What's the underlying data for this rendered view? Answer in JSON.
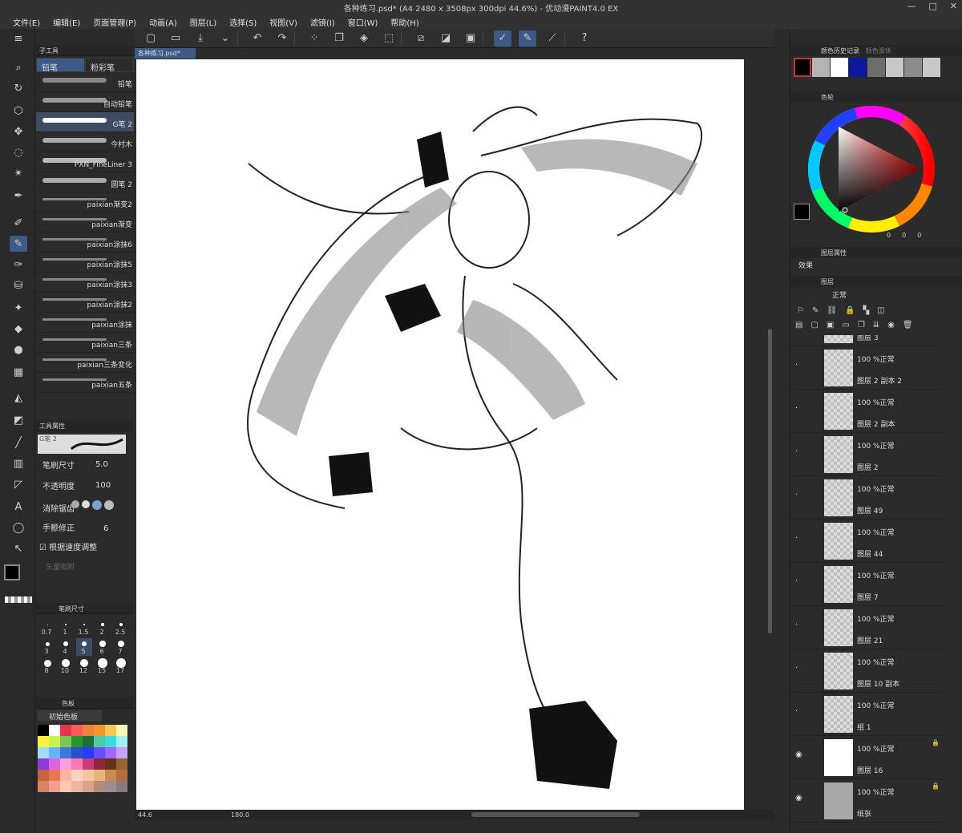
{
  "window": {
    "title": "各种练习.psd* (A4 2480 x 3508px 300dpi 44.6%) - 优动漫PAINT4.0 EX",
    "buttons": [
      "—",
      "□",
      "✕"
    ]
  },
  "menu": [
    "文件(E)",
    "编辑(E)",
    "页面管理(P)",
    "动画(A)",
    "图层(L)",
    "选择(S)",
    "视图(V)",
    "滤镜(I)",
    "窗口(W)",
    "帮助(H)"
  ],
  "subtool": {
    "header": "子工具",
    "tabs": [
      "铅笔",
      "粉彩笔"
    ],
    "brushes": [
      {
        "label": "铅笔",
        "color": "#888"
      },
      {
        "label": "自动铅笔",
        "color": "#9a9a9a"
      },
      {
        "label": "G笔 2",
        "color": "#ffffff"
      },
      {
        "label": "今村木",
        "color": "#aaaaaa"
      },
      {
        "label": "PXN_FineLiner 3",
        "color": "#bbbbbb"
      },
      {
        "label": "圆笔 2",
        "color": "#aaaaaa"
      },
      {
        "label": "paixian渐变2",
        "color": "#888"
      },
      {
        "label": "paixian渐变",
        "color": "#888"
      },
      {
        "label": "paixian涂抹6",
        "color": "#888"
      },
      {
        "label": "paixian涂抹5",
        "color": "#888"
      },
      {
        "label": "paixian涂抹3",
        "color": "#888"
      },
      {
        "label": "paixian涂抹2",
        "color": "#888"
      },
      {
        "label": "paixian涂抹",
        "color": "#888"
      },
      {
        "label": "paixian三条",
        "color": "#888"
      },
      {
        "label": "paixian三条变化",
        "color": "#888"
      },
      {
        "label": "paixian五条",
        "color": "#888"
      }
    ]
  },
  "toolprops": {
    "header": "工具属性",
    "brush_name": "G笔 2",
    "size_label": "笔刷尺寸",
    "size_value": "5.0",
    "opacity_label": "不透明度",
    "opacity_value": "100",
    "antialias_label": "消除锯齿",
    "stabilize_label": "手颤修正",
    "stabilize_value": "6",
    "speed_label": "根据速度调整",
    "vector_label": "矢量吸附"
  },
  "brushsize": {
    "header": "笔刷尺寸",
    "sizes": [
      "0.7",
      "1",
      "1.5",
      "2",
      "2.5",
      "3",
      "4",
      "5",
      "6",
      "7",
      "8",
      "10",
      "12",
      "15",
      "17"
    ],
    "selected": "5"
  },
  "palette": {
    "tabs": [
      "色板",
      "",
      "",
      ""
    ],
    "set_name": "初始色板",
    "colors": [
      "#000000",
      "#ffffff",
      "#e8344c",
      "#ff5a5a",
      "#f0823c",
      "#f59628",
      "#f5c850",
      "#fff5b4",
      "#fff03c",
      "#c8f050",
      "#78c850",
      "#289628",
      "#1e6e3c",
      "#50c8a0",
      "#3cdcdc",
      "#a0f0f0",
      "#a0dcff",
      "#64b4ff",
      "#3c78dc",
      "#2850c8",
      "#283cff",
      "#6450ff",
      "#a064ff",
      "#c8a0ff",
      "#8c3cdc",
      "#dc64dc",
      "#ffa0dc",
      "#ff78b4",
      "#c83c78",
      "#8c283c",
      "#643214",
      "#966432",
      "#c8643c",
      "#e67850",
      "#ffb4a0",
      "#ffd2c8",
      "#f0c8a0",
      "#e6b478",
      "#c88c50",
      "#b46e3c",
      "#dc8264",
      "#f0a08c",
      "#ffc8b4",
      "#f0b4a0",
      "#dca08c",
      "#b48c78",
      "#a08c96",
      "#8c7882"
    ]
  },
  "doc": {
    "tab": "各种练习.psd*"
  },
  "status": {
    "zoom": "44.6",
    "angle": "180.0"
  },
  "colorhistory": {
    "tabs": [
      "颜色历史记录",
      "颜色滑块"
    ],
    "swatches": [
      "#000000",
      "#b4b4b4",
      "#ffffff",
      "#0d1a9c",
      "#6e6e6e",
      "#c8c8c8",
      "#8c8c8c",
      "#c8c8c8"
    ]
  },
  "colorwheel": {
    "header": "色轮",
    "readout": [
      "0",
      "0",
      "0"
    ]
  },
  "layerprops": {
    "header": "图层属性",
    "effect_label": "效果"
  },
  "layers": {
    "header": "图层",
    "blend_mode": "正常",
    "items": [
      {
        "name": "图层 3",
        "mode": "",
        "thumb": "check",
        "visible": false,
        "locked": false
      },
      {
        "name": "图层 2 副本 2",
        "mode": "100 %正常",
        "thumb": "check",
        "visible": false,
        "locked": false
      },
      {
        "name": "图层 2 副本",
        "mode": "100 %正常",
        "thumb": "check",
        "visible": false,
        "locked": false
      },
      {
        "name": "图层 2",
        "mode": "100 %正常",
        "thumb": "check",
        "visible": false,
        "locked": false
      },
      {
        "name": "图层 49",
        "mode": "100 %正常",
        "thumb": "check",
        "visible": false,
        "locked": false
      },
      {
        "name": "图层 44",
        "mode": "100 %正常",
        "thumb": "check",
        "visible": false,
        "locked": false
      },
      {
        "name": "图层 7",
        "mode": "100 %正常",
        "thumb": "check",
        "visible": false,
        "locked": false
      },
      {
        "name": "图层 21",
        "mode": "100 %正常",
        "thumb": "check",
        "visible": false,
        "locked": false
      },
      {
        "name": "图层 10 副本",
        "mode": "100 %正常",
        "thumb": "check",
        "visible": false,
        "locked": false
      },
      {
        "name": "组 1",
        "mode": "100 %正常",
        "thumb": "check",
        "visible": false,
        "locked": false
      },
      {
        "name": "图层 16",
        "mode": "100 %正常",
        "thumb": "white",
        "visible": true,
        "locked": true
      },
      {
        "name": "纸张",
        "mode": "100 %正常",
        "thumb": "grey",
        "visible": true,
        "locked": true
      }
    ]
  },
  "colors": {
    "main": "#000000",
    "sub": "#0d1a9c",
    "accent": "#3d5a86"
  }
}
